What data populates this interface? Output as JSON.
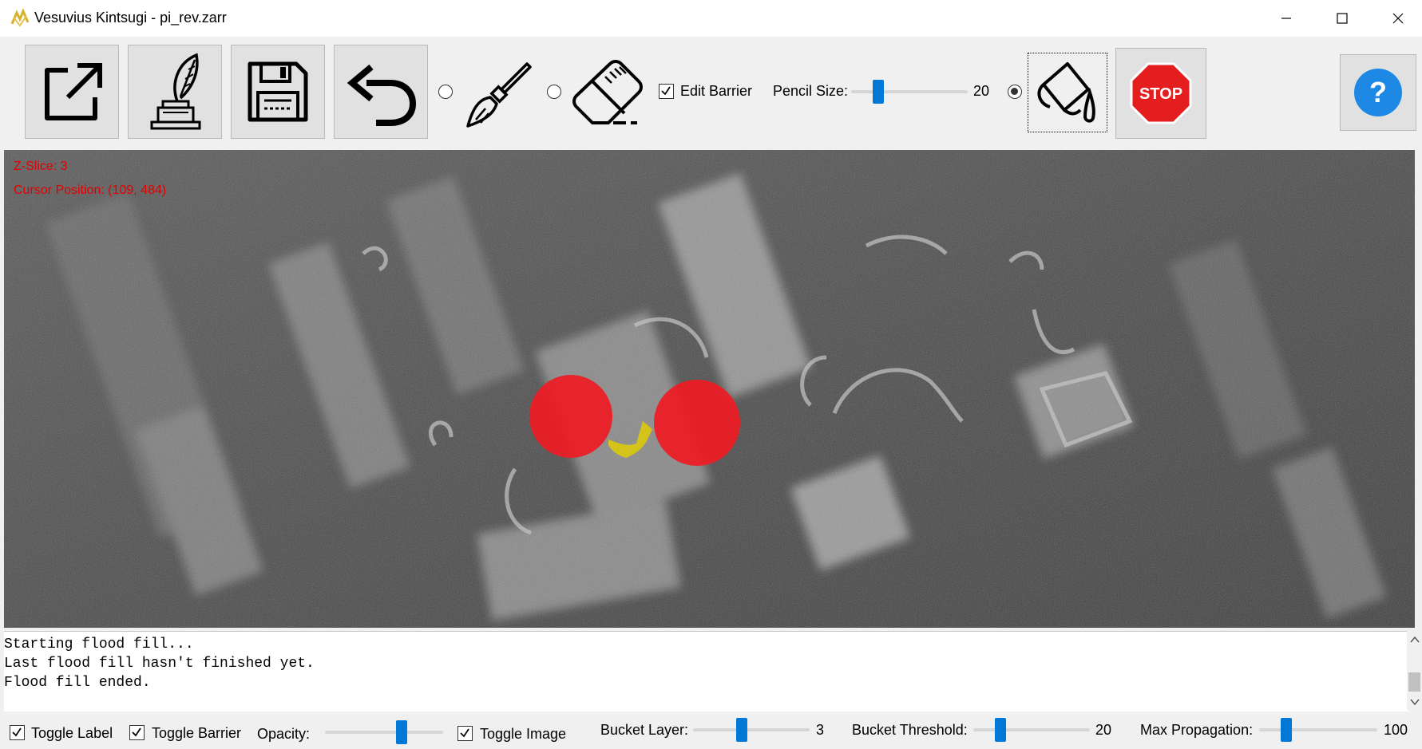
{
  "window": {
    "title": "Vesuvius Kintsugi - pi_rev.zarr"
  },
  "toolbar": {
    "buttons": [
      {
        "name": "open-icon"
      },
      {
        "name": "quill-inkwell-icon"
      },
      {
        "name": "save-icon"
      },
      {
        "name": "undo-icon"
      }
    ],
    "brush_radio": {
      "icon": "brush-icon",
      "checked": false
    },
    "eraser_radio": {
      "icon": "eraser-icon",
      "checked": false
    },
    "edit_barrier": {
      "label": "Edit Barrier",
      "checked": true
    },
    "pencil_size": {
      "label": "Pencil Size:",
      "value": "20",
      "level": 0.2
    },
    "bucket_radio": {
      "icon": "paint-bucket-icon",
      "checked": true
    },
    "stop_label": "STOP",
    "help_label": "?"
  },
  "viewport": {
    "z_slice": "Z-Slice: 3",
    "cursor_position": "Cursor Position: (109, 484)",
    "label_color": "#ee1c24",
    "barrier_color": "#d4c41a"
  },
  "console": {
    "lines": [
      "Starting flood fill...",
      "Last flood fill hasn't finished yet.",
      "Flood fill ended."
    ]
  },
  "bottombar": {
    "toggle_label": {
      "label": "Toggle Label",
      "checked": true
    },
    "toggle_barrier": {
      "label": "Toggle Barrier",
      "checked": true
    },
    "opacity": {
      "label": "Opacity:",
      "level": 0.65
    },
    "toggle_image": {
      "label": "Toggle Image",
      "checked": true
    },
    "bucket_layer": {
      "label": "Bucket Layer:",
      "value": "3"
    },
    "bucket_threshold": {
      "label": "Bucket Threshold:",
      "value": "20"
    },
    "max_propagation": {
      "label": "Max Propagation:",
      "value": "100"
    }
  }
}
